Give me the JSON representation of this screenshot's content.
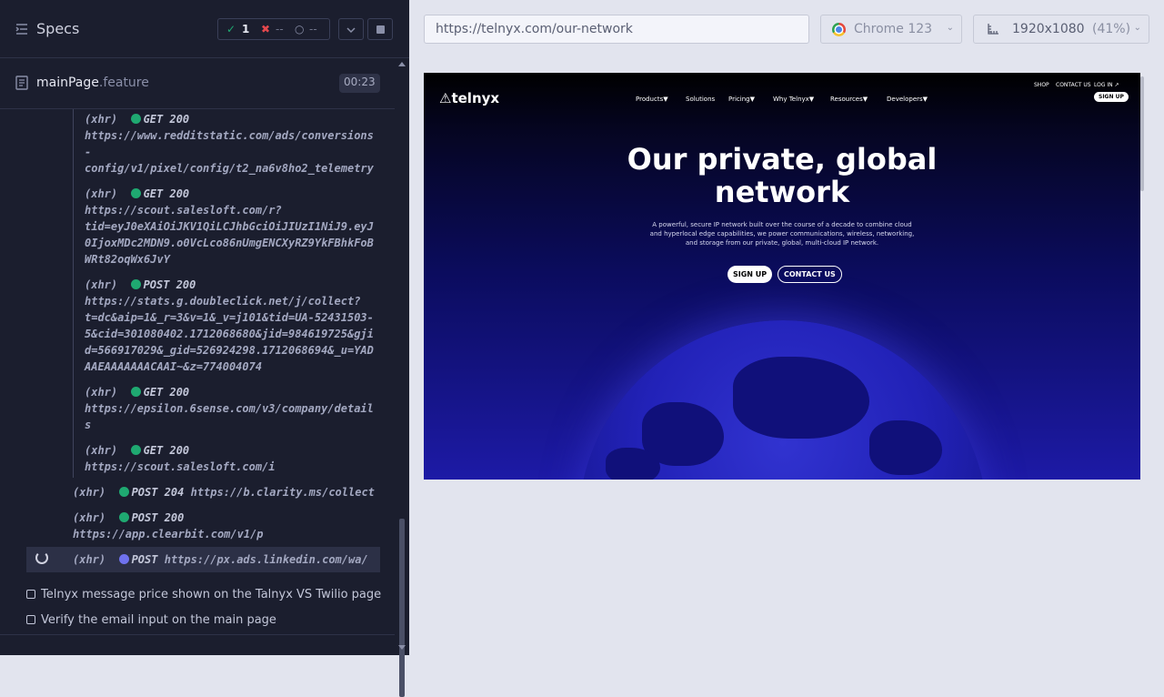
{
  "sidebar": {
    "title": "Specs",
    "stats": {
      "passed": "1",
      "failed": "--",
      "pending": "--"
    },
    "file": {
      "name": "mainPage",
      "ext": ".feature",
      "duration": "00:23"
    }
  },
  "log": {
    "nested": [
      {
        "type": "(xhr)",
        "method": "GET 200",
        "url_lines": [
          "https://www.redditstatic.com/ads/conversions",
          "-",
          "config/v1/pixel/config/t2_na6v8ho2_telemetry"
        ]
      },
      {
        "type": "(xhr)",
        "method": "GET 200",
        "url_lines": [
          "https://scout.salesloft.com/r?",
          "tid=eyJ0eXAiOiJKV1QiLCJhbGciOiJIUzI1NiJ9.eyJ",
          "0IjoxMDc2MDN9.o0VcLco86nUmgENCXyRZ9YkFBhkFoB",
          "WRt82oqWx6JvY"
        ]
      },
      {
        "type": "(xhr)",
        "method": "POST 200",
        "url_lines": [
          "https://stats.g.doubleclick.net/j/collect?",
          "t=dc&aip=1&_r=3&v=1&_v=j101&tid=UA-52431503-",
          "5&cid=301080402.1712068680&jid=984619725&gji",
          "d=566917029&_gid=526924298.1712068694&_u=YAD",
          "AAEAAAAAAACAAI~&z=774004074"
        ]
      },
      {
        "type": "(xhr)",
        "method": "GET 200",
        "url_lines": [
          "https://epsilon.6sense.com/v3/company/detail",
          "s"
        ]
      },
      {
        "type": "(xhr)",
        "method": "GET 200",
        "url_lines": [
          "https://scout.salesloft.com/i"
        ]
      }
    ],
    "outer": [
      {
        "type": "(xhr)",
        "method": "POST 204",
        "url": "https://b.clarity.ms/collect"
      },
      {
        "type": "(xhr)",
        "method": "POST 200",
        "url": "https://app.clearbit.com/v1/p"
      }
    ],
    "pending": {
      "type": "(xhr)",
      "method": "POST",
      "url": "https://px.ads.linkedin.com/wa/"
    }
  },
  "tests": [
    "Telnyx message price shown on the Talnyx VS Twilio page",
    "Verify the email input on the main page"
  ],
  "toolbar": {
    "url": "https://telnyx.com/our-network",
    "browser": "Chrome 123",
    "viewport": "1920x1080",
    "zoom": "(41%)"
  },
  "aut": {
    "logo": "telnyx",
    "nav": [
      "Products▼",
      "Solutions",
      "Pricing▼",
      "Why Telnyx▼",
      "Resources▼",
      "Developers▼"
    ],
    "top_links": [
      "SHOP",
      "CONTACT US",
      "LOG IN ↗"
    ],
    "signup_small": "SIGN UP",
    "hero_title": "Our private, global network",
    "hero_sub": "A powerful, secure IP network built over the course of a decade to combine cloud and hyperlocal edge capabilities, we power communications, wireless, networking, and storage from our private, global, multi-cloud IP network.",
    "btn_signup": "SIGN UP",
    "btn_contact": "CONTACT US"
  },
  "colors": {
    "sidebar_bg": "#1b1e2e",
    "pass": "#1fa971",
    "pending": "#6f72ee",
    "hero_deep": "#1d1aa6"
  }
}
